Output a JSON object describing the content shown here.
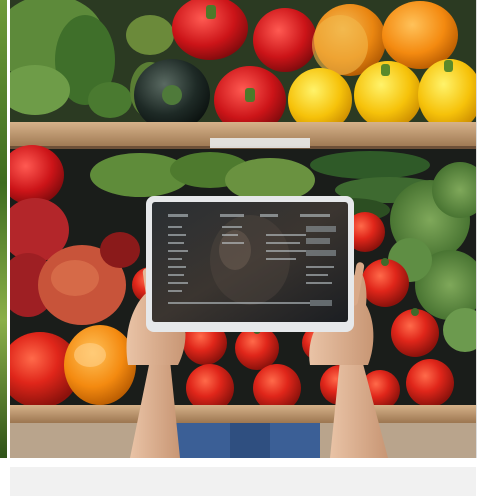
{
  "image": {
    "subject": "tablet-over-produce-shelf",
    "tablet_lines": []
  }
}
